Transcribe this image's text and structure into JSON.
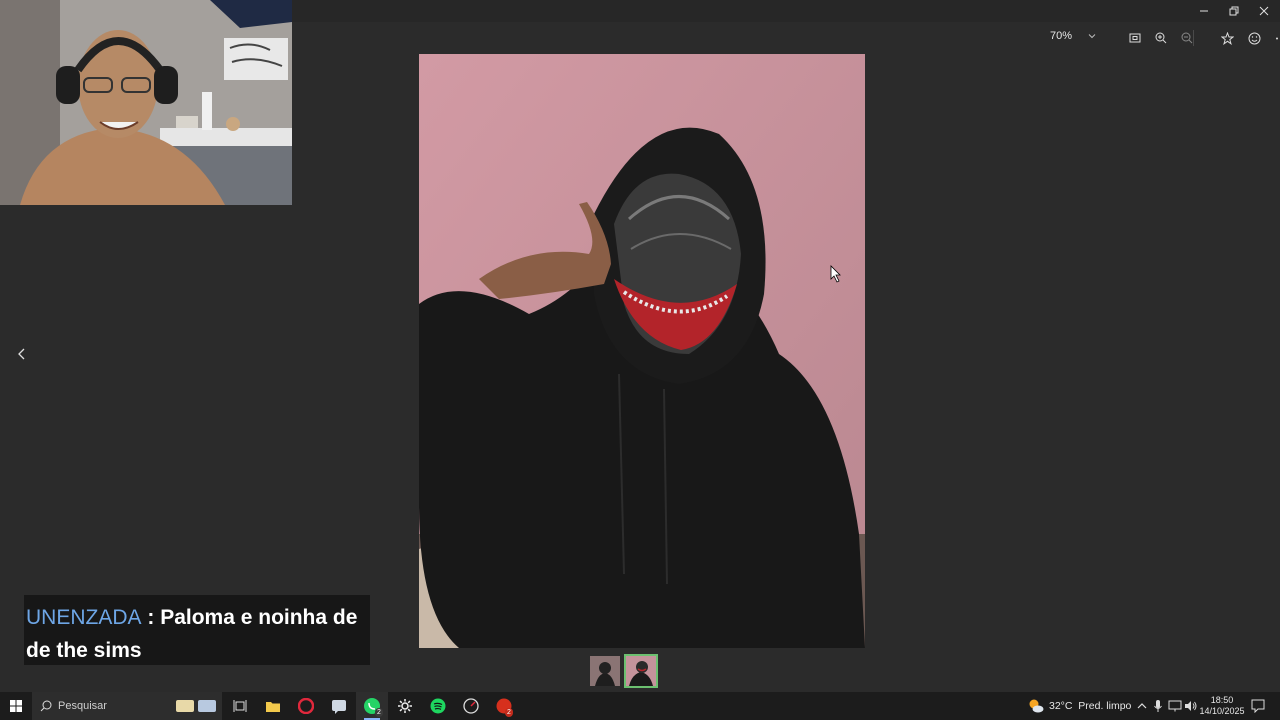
{
  "window": {
    "minimize_icon": "minimize-icon",
    "restore_icon": "restore-icon",
    "close_icon": "close-icon"
  },
  "viewer_toolbar": {
    "zoom_level": "70%",
    "icons": [
      "zoom-dropdown-chevron-icon",
      "fit-screen-icon",
      "zoom-in-icon",
      "zoom-out-icon",
      "favorite-star-icon",
      "emoji-react-icon",
      "more-options-icon"
    ]
  },
  "navigation": {
    "previous_icon": "chevron-left-icon"
  },
  "thumbnails": {
    "count": 2,
    "active_index": 1
  },
  "chat_overlay": {
    "username": "UNENZADA",
    "separator": " : ",
    "message": "Paloma e noinha de de the sims"
  },
  "taskbar": {
    "search_placeholder": "Pesquisar",
    "weather": "32°C  Pred. limpo",
    "time": "18:50",
    "date": "14/10/2025",
    "whatsapp_badge": "2",
    "red_app_badge": "2",
    "accent": "#8ab4f8"
  },
  "colors": {
    "background": "#2b2b2b",
    "thumb_active": "#6cc070",
    "chat_user": "#6ea6e6"
  }
}
